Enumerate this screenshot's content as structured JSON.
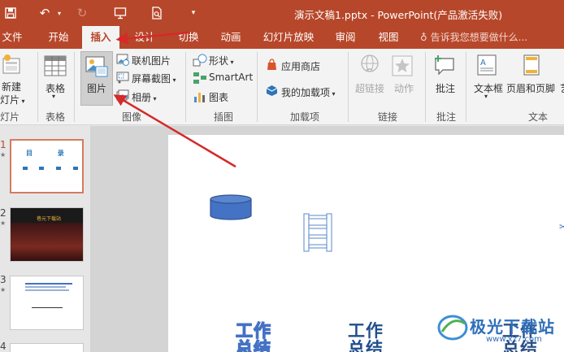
{
  "window": {
    "title": "演示文稿1.pptx - PowerPoint(产品激活失败)"
  },
  "tabs": [
    "文件",
    "开始",
    "插入",
    "设计",
    "切换",
    "动画",
    "幻灯片放映",
    "审阅",
    "视图"
  ],
  "active_tab": "插入",
  "tell_me": "告诉我您想要做什么...",
  "ribbon": {
    "slides": {
      "new_slide": "新建\n幻灯片",
      "new_slide_top": "新建",
      "new_slide_bottom": "灯片",
      "group": "灯片"
    },
    "tables": {
      "table": "表格",
      "group": "表格"
    },
    "images": {
      "picture": "图片",
      "online_pictures": "联机图片",
      "screenshot": "屏幕截图",
      "album": "相册",
      "group": "图像"
    },
    "illustrations": {
      "shapes": "形状",
      "smartart": "SmartArt",
      "chart": "图表",
      "group": "插图"
    },
    "addins": {
      "store": "应用商店",
      "my_addins": "我的加载项",
      "group": "加载项"
    },
    "links": {
      "hyperlink": "超链接",
      "action": "动作",
      "group": "链接"
    },
    "comments": {
      "comment": "批注",
      "group": "批注"
    },
    "text": {
      "textbox": "文本框",
      "header_footer": "页眉和页脚",
      "group": "文本",
      "more": "艺"
    }
  },
  "slides_panel": {
    "slides": [
      {
        "number": "1",
        "thumb_title": "目 录"
      },
      {
        "number": "2",
        "thumb_title": "巷元下载站"
      },
      {
        "number": "3"
      },
      {
        "number": "4"
      }
    ]
  },
  "slide": {
    "wordart": [
      "工作\n总结",
      "工作\n总结",
      "工作\n总结"
    ],
    "wa1_top": "工作",
    "wa1_bottom": "总结",
    "wa2_top": "工作",
    "wa2_bottom": "总结",
    "wa3_top": "工作",
    "wa3_bottom": "总结"
  },
  "watermark": {
    "text": "极光下载站",
    "url": "www.xz7.com"
  },
  "colors": {
    "accent": "#b7472a",
    "ribbon_bg": "#f3f3f3",
    "arrow": "#d42a2a",
    "shape_blue": "#4472c4"
  }
}
